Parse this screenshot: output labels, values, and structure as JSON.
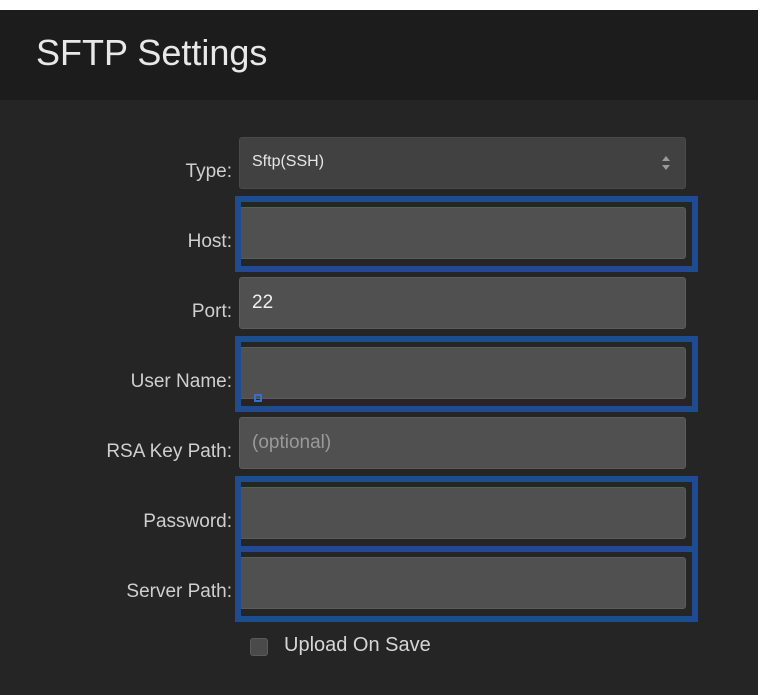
{
  "header": {
    "title": "SFTP Settings"
  },
  "form": {
    "type": {
      "label": "Type:",
      "value": "Sftp(SSH)",
      "options": [
        "Sftp(SSH)"
      ]
    },
    "host": {
      "label": "Host:",
      "value": ""
    },
    "port": {
      "label": "Port:",
      "value": "22"
    },
    "user_name": {
      "label": "User Name:",
      "value": ""
    },
    "rsa_key_path": {
      "label": "RSA Key Path:",
      "placeholder": "(optional)"
    },
    "password": {
      "label": "Password:",
      "value": ""
    },
    "server_path": {
      "label": "Server Path:",
      "value": ""
    },
    "upload_on_save": {
      "label": "Upload On Save",
      "checked": false
    }
  },
  "colors": {
    "panel_bg": "#252525",
    "header_bg": "#1c1c1c",
    "field_bg": "#505050",
    "highlight": "#1f4b91"
  },
  "icons": {
    "select_arrows": "updown-chevrons-icon",
    "checkbox": "checkbox-unchecked-icon"
  }
}
